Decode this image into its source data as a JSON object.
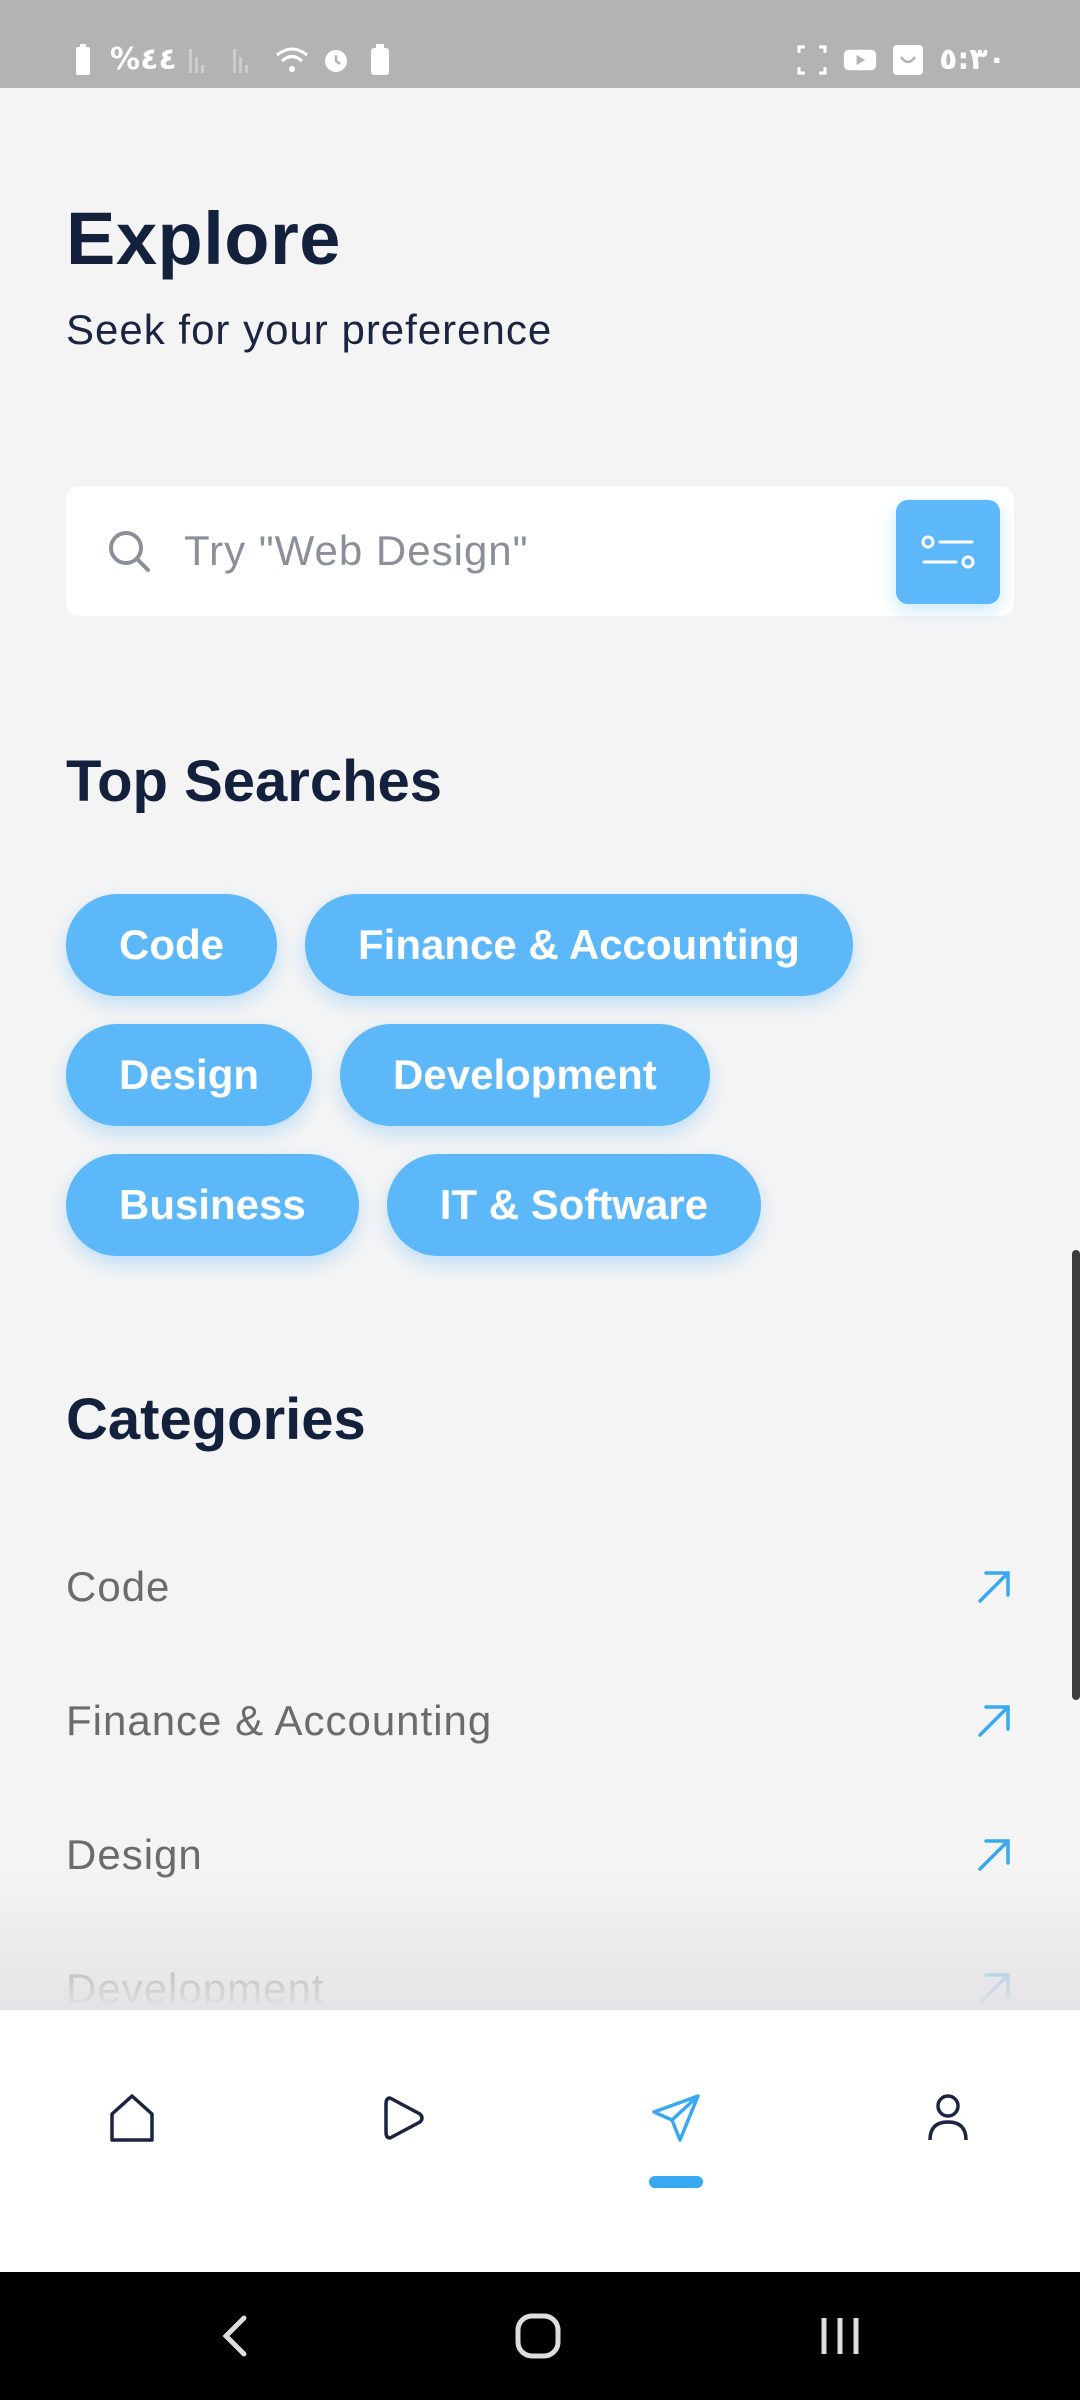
{
  "status_bar": {
    "battery_percent": "%٤٤",
    "time": "٥:٣٠"
  },
  "header": {
    "title": "Explore",
    "subtitle": "Seek for your preference"
  },
  "search": {
    "placeholder": "Try \"Web Design\"",
    "value": ""
  },
  "top_searches": {
    "title": "Top Searches",
    "chips": [
      "Code",
      "Finance & Accounting",
      "Design",
      "Development",
      "Business",
      "IT & Software"
    ]
  },
  "categories": {
    "title": "Categories",
    "items": [
      "Code",
      "Finance & Accounting",
      "Design",
      "Development"
    ]
  },
  "colors": {
    "accent": "#5cb8f8",
    "title": "#14213d",
    "muted_text": "#6b6b6b"
  },
  "bottom_nav": {
    "items": [
      "home-icon",
      "play-icon",
      "explore-icon",
      "profile-icon"
    ],
    "active_index": 2
  }
}
